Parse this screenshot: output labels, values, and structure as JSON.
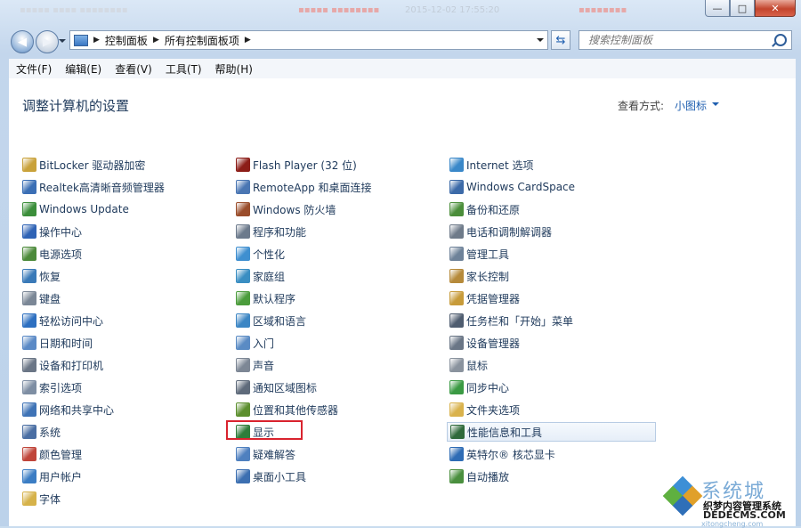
{
  "titlebar": {
    "ghost_items": [
      {
        "text": "▪▪▪▪▪ ▪▪▪▪ ▪▪▪▪▪▪▪▪",
        "color": "#d3dae3"
      },
      {
        "text": "▪▪▪▪▪ ▪▪▪▪▪▪▪▪",
        "color": "#e6a8a8"
      },
      {
        "text": "2015-12-02 17:55:20",
        "color": "#c2ccd8"
      },
      {
        "text": "▪▪▪▪▪▪▪▪",
        "color": "#e6a8a8"
      }
    ],
    "buttons": {
      "minimize": "—",
      "maximize": "□",
      "close": "✕"
    }
  },
  "navigation": {
    "back_icon": "back-arrow-icon",
    "forward_icon": "forward-arrow-icon",
    "breadcrumb": [
      "控制面板",
      "所有控制面板项"
    ],
    "search_placeholder": "搜索控制面板"
  },
  "menu": [
    "文件(F)",
    "编辑(E)",
    "查看(V)",
    "工具(T)",
    "帮助(H)"
  ],
  "content": {
    "heading": "调整计算机的设置",
    "view_label": "查看方式:",
    "view_value": "小图标"
  },
  "columns": [
    [
      {
        "label": "BitLocker 驱动器加密",
        "icon": "bitlocker-icon",
        "color": "#c9a23a"
      },
      {
        "label": "Realtek高清晰音频管理器",
        "icon": "realtek-audio-icon",
        "color": "#3b6fb5"
      },
      {
        "label": "Windows Update",
        "icon": "windows-update-icon",
        "color": "#3b8e3a"
      },
      {
        "label": "操作中心",
        "icon": "action-center-flag-icon",
        "color": "#2f63b5"
      },
      {
        "label": "电源选项",
        "icon": "power-options-icon",
        "color": "#4c8a3a"
      },
      {
        "label": "恢复",
        "icon": "recovery-icon",
        "color": "#3a7ab8"
      },
      {
        "label": "键盘",
        "icon": "keyboard-icon",
        "color": "#7b8796"
      },
      {
        "label": "轻松访问中心",
        "icon": "ease-of-access-icon",
        "color": "#2d6fc0"
      },
      {
        "label": "日期和时间",
        "icon": "date-time-icon",
        "color": "#5b8ac6"
      },
      {
        "label": "设备和打印机",
        "icon": "devices-printers-icon",
        "color": "#6b7686"
      },
      {
        "label": "索引选项",
        "icon": "indexing-options-icon",
        "color": "#7e8ea3"
      },
      {
        "label": "网络和共享中心",
        "icon": "network-sharing-icon",
        "color": "#3f73b6"
      },
      {
        "label": "系统",
        "icon": "system-icon",
        "color": "#4a6ea3"
      },
      {
        "label": "颜色管理",
        "icon": "color-management-icon",
        "color": "#c0453a"
      },
      {
        "label": "用户帐户",
        "icon": "user-accounts-icon",
        "color": "#3b7dc4"
      },
      {
        "label": "字体",
        "icon": "fonts-folder-icon",
        "color": "#d6b24a"
      }
    ],
    [
      {
        "label": "Flash Player (32 位)",
        "icon": "flash-player-icon",
        "color": "#8c1d18"
      },
      {
        "label": "RemoteApp 和桌面连接",
        "icon": "remoteapp-icon",
        "color": "#4a76b3"
      },
      {
        "label": "Windows 防火墙",
        "icon": "firewall-icon",
        "color": "#9a4d2b"
      },
      {
        "label": "程序和功能",
        "icon": "programs-features-icon",
        "color": "#6c7a8c"
      },
      {
        "label": "个性化",
        "icon": "personalization-icon",
        "color": "#3f8fd0"
      },
      {
        "label": "家庭组",
        "icon": "homegroup-icon",
        "color": "#3a8ec2"
      },
      {
        "label": "默认程序",
        "icon": "default-programs-icon",
        "color": "#4b9c3c"
      },
      {
        "label": "区域和语言",
        "icon": "region-language-icon",
        "color": "#3c86c4"
      },
      {
        "label": "入门",
        "icon": "getting-started-icon",
        "color": "#5a8bc4"
      },
      {
        "label": "声音",
        "icon": "sound-icon",
        "color": "#7d8795"
      },
      {
        "label": "通知区域图标",
        "icon": "notification-area-icon",
        "color": "#5f6b7b"
      },
      {
        "label": "位置和其他传感器",
        "icon": "location-sensors-icon",
        "color": "#5c8f2e"
      },
      {
        "label": "显示",
        "icon": "display-icon",
        "color": "#2f7d3a"
      },
      {
        "label": "疑难解答",
        "icon": "troubleshooting-icon",
        "color": "#4f80bf"
      },
      {
        "label": "桌面小工具",
        "icon": "desktop-gadgets-icon",
        "color": "#3c6fb1"
      }
    ],
    [
      {
        "label": "Internet 选项",
        "icon": "internet-options-icon",
        "color": "#3a88c9"
      },
      {
        "label": "Windows CardSpace",
        "icon": "cardspace-icon",
        "color": "#3c6aa8"
      },
      {
        "label": "备份和还原",
        "icon": "backup-restore-icon",
        "color": "#4b8e3a"
      },
      {
        "label": "电话和调制解调器",
        "icon": "phone-modem-icon",
        "color": "#6f7b8a"
      },
      {
        "label": "管理工具",
        "icon": "admin-tools-icon",
        "color": "#6e8299"
      },
      {
        "label": "家长控制",
        "icon": "parental-controls-icon",
        "color": "#b68a3a"
      },
      {
        "label": "凭据管理器",
        "icon": "credential-manager-icon",
        "color": "#c79b3a"
      },
      {
        "label": "任务栏和「开始」菜单",
        "icon": "taskbar-start-menu-icon",
        "color": "#4f5d70"
      },
      {
        "label": "设备管理器",
        "icon": "device-manager-icon",
        "color": "#6a7686"
      },
      {
        "label": "鼠标",
        "icon": "mouse-icon",
        "color": "#8a939e"
      },
      {
        "label": "同步中心",
        "icon": "sync-center-icon",
        "color": "#3a9a43"
      },
      {
        "label": "文件夹选项",
        "icon": "folder-options-icon",
        "color": "#d9b24c"
      },
      {
        "label": "性能信息和工具",
        "icon": "performance-tools-icon",
        "color": "#2f6a3c",
        "highlighted": true
      },
      {
        "label": "英特尔® 核芯显卡",
        "icon": "intel-graphics-icon",
        "color": "#2e6cb5"
      },
      {
        "label": "自动播放",
        "icon": "autoplay-icon",
        "color": "#4a8f3e"
      }
    ]
  ],
  "watermark": {
    "brand": "系统城",
    "line1": "织梦内容管理系统",
    "line2": "DEDECMS.COM",
    "line3": "xitongcheng.com",
    "colors": [
      "#3c8fd6",
      "#5fb040",
      "#e0a02a",
      "#2f6fb8"
    ]
  }
}
